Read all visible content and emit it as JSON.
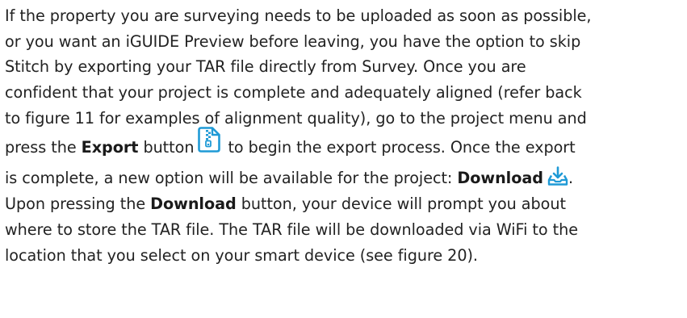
{
  "icons": {
    "export": "export-tar-file-icon",
    "download": "download-tray-icon"
  },
  "colors": {
    "text": "#222222",
    "icon_blue": "#1f9ad6"
  },
  "paragraph": {
    "line1": "If the property you are surveying needs to be uploaded as soon as possible,",
    "line2": "or you want an iGUIDE Preview before leaving, you have the option to skip",
    "line3": "Stitch by exporting your TAR file directly from Survey. Once you are",
    "line4": "confident that your project is complete and adequately aligned (refer back",
    "line5": "to figure 11 for examples of alignment quality), go to the project menu and",
    "line6_pre": "press the ",
    "line6_bold": "Export",
    "line6_mid": " button",
    "line6_post": "to begin the export process. Once the export",
    "line7_pre": "is complete, a new option will be available for the project: ",
    "line7_bold": "Download",
    "line7_post": ".",
    "line8_pre": "Upon pressing the ",
    "line8_bold": "Download",
    "line8_post": " button, your device will prompt you about",
    "line9": "where to store the TAR file. The TAR file will be downloaded via WiFi to the",
    "line10": "location that you select on your smart device (see figure 20)."
  }
}
